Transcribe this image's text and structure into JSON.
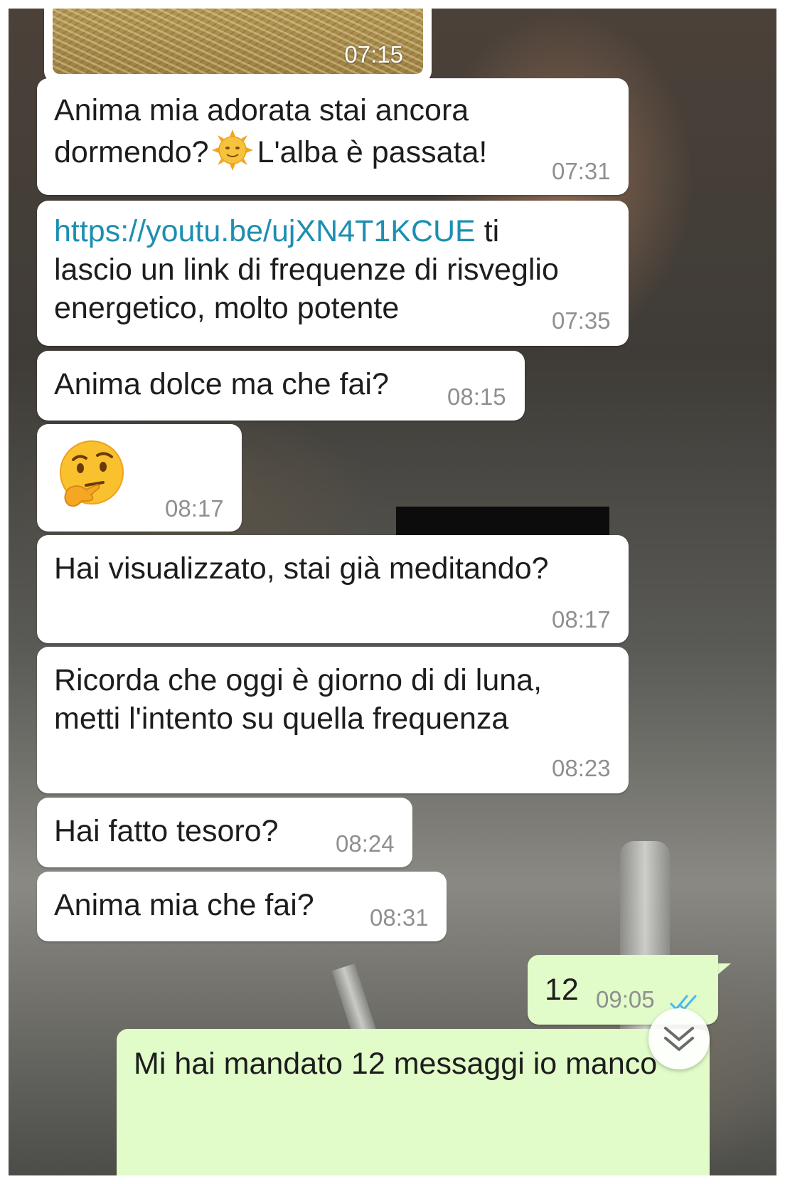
{
  "chat": {
    "photo_message": {
      "time": "07:15"
    },
    "incoming_messages": [
      {
        "line1": "Anima mia adorata stai ancora",
        "line2_pre": "dormendo?",
        "emoji": "sun-with-face-emoji",
        "line2_post": "L'alba è passata!",
        "time": "07:31"
      },
      {
        "link": "https://youtu.be/ujXN4T1KCUE",
        "line1_post": " ti",
        "line2": "lascio un link di frequenze di risveglio",
        "line3": "energetico, molto potente",
        "time": "07:35"
      },
      {
        "text": "Anima dolce ma che fai?",
        "time": "08:15"
      },
      {
        "emoji": "thinking-face-emoji",
        "time": "08:17"
      },
      {
        "text": "Hai visualizzato, stai già meditando?",
        "time": "08:17"
      },
      {
        "line1": "Ricorda che oggi è giorno di di luna,",
        "line2": "metti l'intento su quella frequenza",
        "time": "08:23"
      },
      {
        "text": "Hai fatto tesoro?",
        "time": "08:24"
      },
      {
        "text": "Anima mia che fai?",
        "time": "08:31"
      }
    ],
    "outgoing_messages": [
      {
        "text": "12",
        "time": "09:05",
        "status_icon": "double-check-icon",
        "status": "read"
      },
      {
        "text": "Mi hai mandato 12 messaggi io manco"
      }
    ]
  },
  "controls": {
    "scroll_down_icon": "chevron-double-down-icon"
  },
  "colors": {
    "incoming_bubble": "#ffffff",
    "outgoing_bubble": "#e1fbc9",
    "link": "#1c8fb1",
    "timestamp": "#8f8f8f",
    "read_ticks": "#4fb6ec"
  }
}
